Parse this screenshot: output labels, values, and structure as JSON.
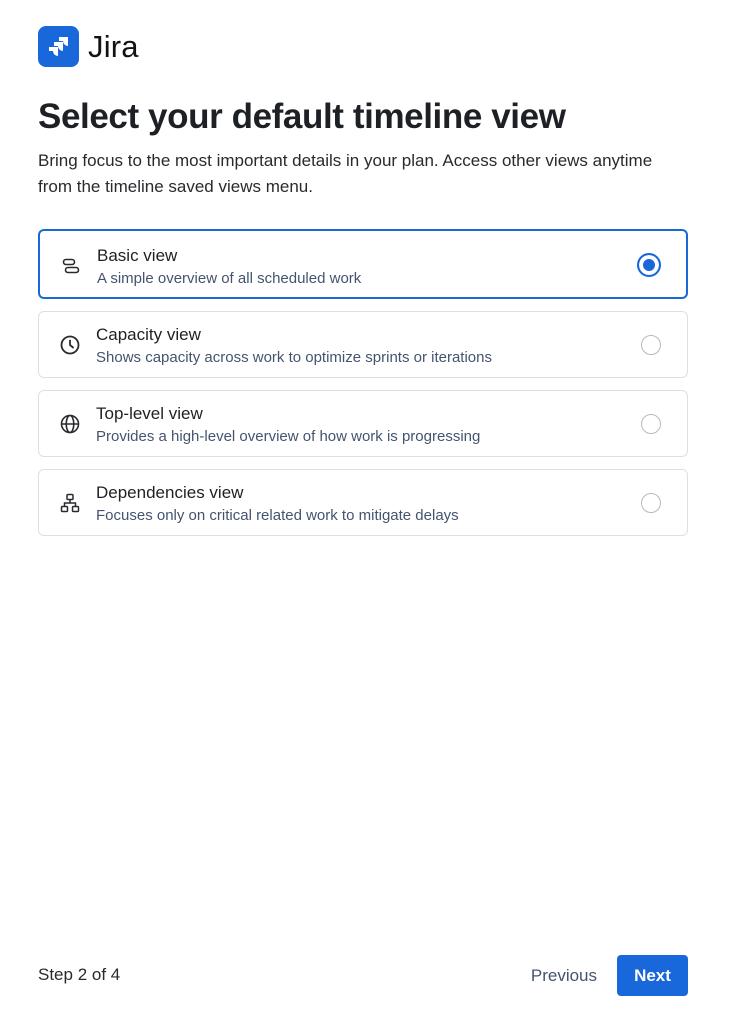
{
  "brand": {
    "name": "Jira",
    "color": "#1868db",
    "icon": "jira-logo-icon"
  },
  "title": "Select your default timeline view",
  "subtitle": "Bring focus to the most important details in your plan. Access other views anytime from the timeline saved views menu.",
  "options": [
    {
      "title": "Basic view",
      "description": "A simple overview of all scheduled work",
      "icon": "basic-view-icon",
      "selected": true
    },
    {
      "title": "Capacity view",
      "description": "Shows capacity across work to optimize sprints or iterations",
      "icon": "clock-icon",
      "selected": false
    },
    {
      "title": "Top-level view",
      "description": "Provides a high-level overview of how work is progressing",
      "icon": "globe-icon",
      "selected": false
    },
    {
      "title": "Dependencies view",
      "description": "Focuses only on critical related work to mitigate delays",
      "icon": "hierarchy-icon",
      "selected": false
    }
  ],
  "footer": {
    "step": "Step 2 of 4",
    "previous_label": "Previous",
    "next_label": "Next"
  }
}
